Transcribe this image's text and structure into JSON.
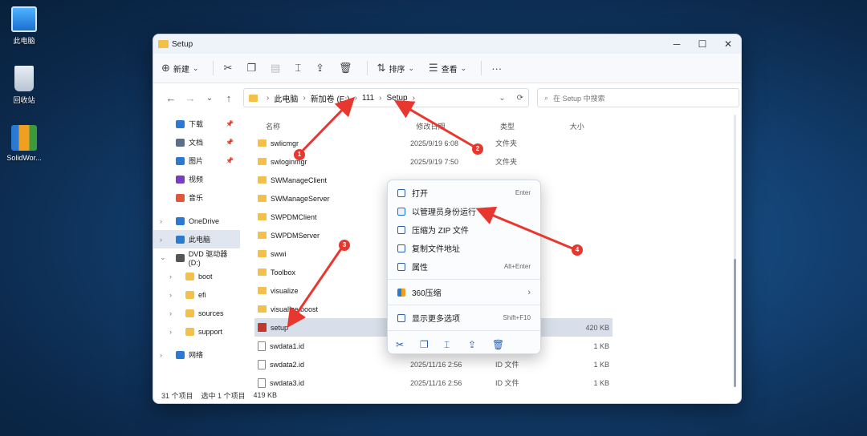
{
  "desktop": [
    {
      "label": "此电脑"
    },
    {
      "label": "回收站"
    },
    {
      "label": "SolidWor..."
    }
  ],
  "window": {
    "title": "Setup",
    "min": "─",
    "max": "☐",
    "close": "✕"
  },
  "toolbar": {
    "new": "新建",
    "sort": "排序",
    "view": "查看",
    "more": "···"
  },
  "address": {
    "back": "←",
    "forward": "→",
    "down": "⌄",
    "up": "↑",
    "crumbs": [
      "此电脑",
      "新加卷 (E:)",
      "111",
      "Setup"
    ],
    "refresh": "⟳",
    "search_placeholder": "在 Setup 中搜索"
  },
  "sidebar": [
    {
      "label": "下载",
      "color": "#2a7ad1",
      "pin": true
    },
    {
      "label": "文档",
      "color": "#5a6f8a",
      "pin": true
    },
    {
      "label": "图片",
      "color": "#2a7ad1",
      "pin": true
    },
    {
      "label": "视频",
      "color": "#7a3cc2",
      "pin": false
    },
    {
      "label": "音乐",
      "color": "#e0573a",
      "pin": false
    },
    {
      "label": "OneDrive",
      "color": "#2a7ad1",
      "pin": false
    },
    {
      "label": "此电脑",
      "color": "#2a7ad1",
      "pin": false
    },
    {
      "label": "DVD 驱动器 (D:)",
      "color": "#555",
      "pin": false
    },
    {
      "label": "boot",
      "color": "#f3c14a",
      "pin": false
    },
    {
      "label": "efi",
      "color": "#f3c14a",
      "pin": false
    },
    {
      "label": "sources",
      "color": "#f3c14a",
      "pin": false
    },
    {
      "label": "support",
      "color": "#f3c14a",
      "pin": false
    },
    {
      "label": "网络",
      "color": "#2a7ad1",
      "pin": false
    }
  ],
  "columns": {
    "name": "名称",
    "date": "修改日期",
    "type": "类型",
    "size": "大小"
  },
  "files": [
    {
      "name": "swlicmgr",
      "date": "2025/9/19 6:08",
      "type": "文件夹",
      "size": "",
      "kind": "folder"
    },
    {
      "name": "swloginmgr",
      "date": "2025/9/19 7:50",
      "type": "文件夹",
      "size": "",
      "kind": "folder"
    },
    {
      "name": "SWManageClient",
      "date": "",
      "type": "",
      "size": "",
      "kind": "folder"
    },
    {
      "name": "SWManageServer",
      "date": "",
      "type": "",
      "size": "",
      "kind": "folder"
    },
    {
      "name": "SWPDMClient",
      "date": "",
      "type": "",
      "size": "",
      "kind": "folder"
    },
    {
      "name": "SWPDMServer",
      "date": "",
      "type": "",
      "size": "",
      "kind": "folder"
    },
    {
      "name": "swwi",
      "date": "",
      "type": "",
      "size": "",
      "kind": "folder"
    },
    {
      "name": "Toolbox",
      "date": "",
      "type": "",
      "size": "",
      "kind": "folder"
    },
    {
      "name": "visualize",
      "date": "",
      "type": "",
      "size": "",
      "kind": "folder"
    },
    {
      "name": "visualize boost",
      "date": "",
      "type": "",
      "size": "",
      "kind": "folder"
    },
    {
      "name": "setup",
      "date": "",
      "type": "",
      "size": "420 KB",
      "kind": "app"
    },
    {
      "name": "swdata1.id",
      "date": "",
      "type": "",
      "size": "1 KB",
      "kind": "file"
    },
    {
      "name": "swdata2.id",
      "date": "2025/11/16 2:56",
      "type": "ID 文件",
      "size": "1 KB",
      "kind": "file"
    },
    {
      "name": "swdata3.id",
      "date": "2025/11/16 2:56",
      "type": "ID 文件",
      "size": "1 KB",
      "kind": "file"
    }
  ],
  "status": {
    "count": "31 个项目",
    "selected": "选中 1 个项目",
    "size": "419 KB"
  },
  "context_menu": {
    "open": "打开",
    "open_acc": "Enter",
    "runas": "以管理员身份运行",
    "zip": "压缩为 ZIP 文件",
    "copypath": "复制文件地址",
    "props": "属性",
    "props_acc": "Alt+Enter",
    "z360": "360压缩",
    "more": "显示更多选项",
    "more_acc": "Shift+F10"
  },
  "badges": [
    "1",
    "2",
    "3",
    "4"
  ]
}
